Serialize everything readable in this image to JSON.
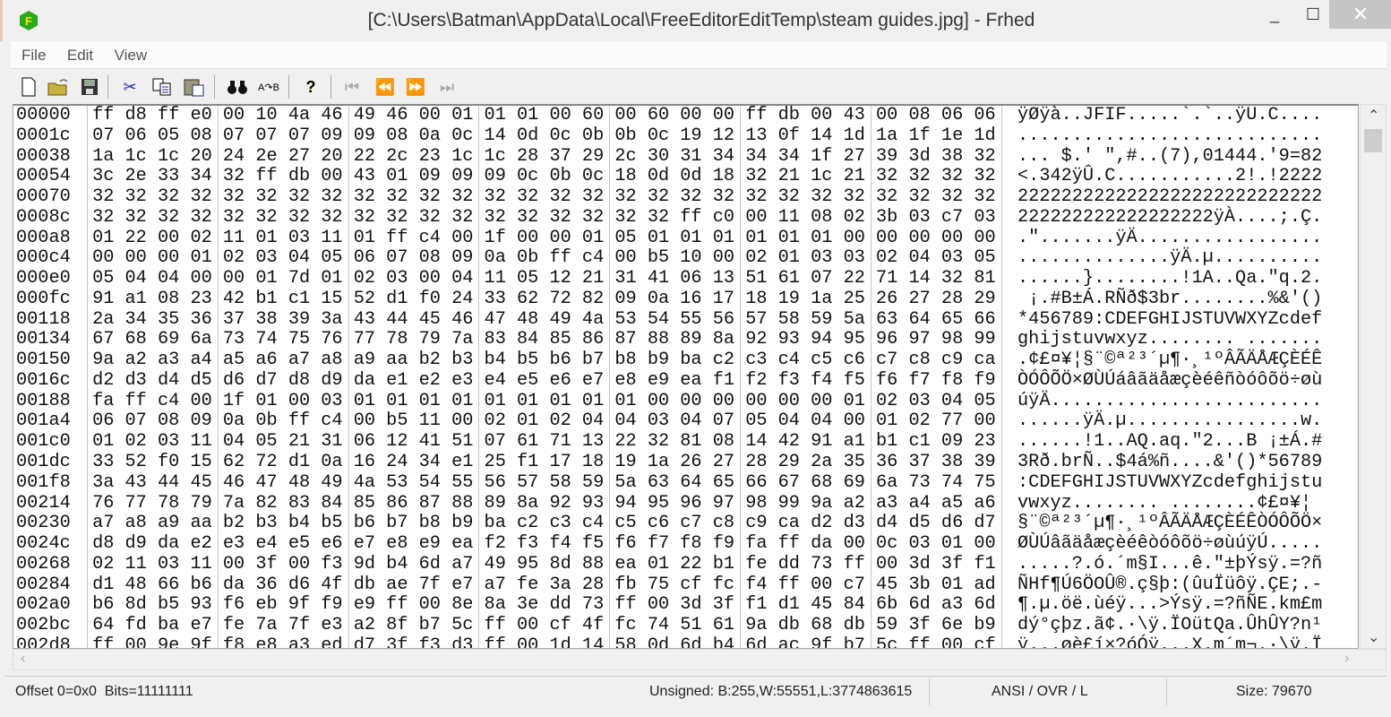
{
  "window": {
    "title": "[C:\\Users\\Batman\\AppData\\Local\\FreeEditorEditTemp\\steam guides.jpg] - Frhed",
    "app_icon_letter": "F",
    "minimize": "_",
    "maximize": "☐",
    "close": "✕"
  },
  "menu": [
    "File",
    "Edit",
    "View"
  ],
  "toolbar": {
    "icons": [
      "new-file-icon",
      "open-folder-icon",
      "save-icon",
      "cut-icon",
      "copy-icon",
      "paste-icon",
      "find-icon",
      "goto-icon",
      "help-icon",
      "first-icon",
      "previous-icon",
      "next-icon",
      "last-icon"
    ]
  },
  "colors": {
    "close_bg": "#c6c6c6",
    "app_icon": "#2aa81c"
  },
  "rows": [
    {
      "offset": "00000",
      "hex": "ff d8 ff e0 00 10 4a 46 49 46 00 01 01 01 00 60 00 60 00 00 ff db 00 43 00 08 06 06",
      "ascii": "ÿØÿà..JFIF.....`.`..ÿÛ.C...."
    },
    {
      "offset": "0001c",
      "hex": "07 06 05 08 07 07 07 09 09 08 0a 0c 14 0d 0c 0b 0b 0c 19 12 13 0f 14 1d 1a 1f 1e 1d",
      "ascii": "............................"
    },
    {
      "offset": "00038",
      "hex": "1a 1c 1c 20 24 2e 27 20 22 2c 23 1c 1c 28 37 29 2c 30 31 34 34 34 1f 27 39 3d 38 32",
      "ascii": "... $.' \",#..(7),01444.'9=82"
    },
    {
      "offset": "00054",
      "hex": "3c 2e 33 34 32 ff db 00 43 01 09 09 09 0c 0b 0c 18 0d 0d 18 32 21 1c 21 32 32 32 32",
      "ascii": "<.342ÿÛ.C...........2!.!2222"
    },
    {
      "offset": "00070",
      "hex": "32 32 32 32 32 32 32 32 32 32 32 32 32 32 32 32 32 32 32 32 32 32 32 32 32 32 32 32",
      "ascii": "2222222222222222222222222222"
    },
    {
      "offset": "0008c",
      "hex": "32 32 32 32 32 32 32 32 32 32 32 32 32 32 32 32 32 32 ff c0 00 11 08 02 3b 03 c7 03",
      "ascii": "222222222222222222ÿÀ....;.Ç."
    },
    {
      "offset": "000a8",
      "hex": "01 22 00 02 11 01 03 11 01 ff c4 00 1f 00 00 01 05 01 01 01 01 01 01 00 00 00 00 00",
      "ascii": ".\".......ÿÄ................."
    },
    {
      "offset": "000c4",
      "hex": "00 00 00 01 02 03 04 05 06 07 08 09 0a 0b ff c4 00 b5 10 00 02 01 03 03 02 04 03 05",
      "ascii": "..............ÿÄ.µ.........."
    },
    {
      "offset": "000e0",
      "hex": "05 04 04 00 00 01 7d 01 02 03 00 04 11 05 12 21 31 41 06 13 51 61 07 22 71 14 32 81",
      "ascii": "......}........!1A..Qa.\"q.2."
    },
    {
      "offset": "000fc",
      "hex": "91 a1 08 23 42 b1 c1 15 52 d1 f0 24 33 62 72 82 09 0a 16 17 18 19 1a 25 26 27 28 29",
      "ascii": " ¡.#B±Á.RÑð$3br........%&'()"
    },
    {
      "offset": "00118",
      "hex": "2a 34 35 36 37 38 39 3a 43 44 45 46 47 48 49 4a 53 54 55 56 57 58 59 5a 63 64 65 66",
      "ascii": "*456789:CDEFGHIJSTUVWXYZcdef"
    },
    {
      "offset": "00134",
      "hex": "67 68 69 6a 73 74 75 76 77 78 79 7a 83 84 85 86 87 88 89 8a 92 93 94 95 96 97 98 99",
      "ascii": "ghijstuvwxyz........ ......."
    },
    {
      "offset": "00150",
      "hex": "9a a2 a3 a4 a5 a6 a7 a8 a9 aa b2 b3 b4 b5 b6 b7 b8 b9 ba c2 c3 c4 c5 c6 c7 c8 c9 ca",
      "ascii": ".¢£¤¥¦§¨©ª²³´µ¶·¸¹ºÂÃÄÅÆÇÈÉÊ"
    },
    {
      "offset": "0016c",
      "hex": "d2 d3 d4 d5 d6 d7 d8 d9 da e1 e2 e3 e4 e5 e6 e7 e8 e9 ea f1 f2 f3 f4 f5 f6 f7 f8 f9",
      "ascii": "ÒÓÔÕÖ×ØÙÚáâãäåæçèéêñòóôõö÷øù"
    },
    {
      "offset": "00188",
      "hex": "fa ff c4 00 1f 01 00 03 01 01 01 01 01 01 01 01 01 00 00 00 00 00 00 01 02 03 04 05",
      "ascii": "úÿÄ........................."
    },
    {
      "offset": "001a4",
      "hex": "06 07 08 09 0a 0b ff c4 00 b5 11 00 02 01 02 04 04 03 04 07 05 04 04 00 01 02 77 00",
      "ascii": "......ÿÄ.µ................w."
    },
    {
      "offset": "001c0",
      "hex": "01 02 03 11 04 05 21 31 06 12 41 51 07 61 71 13 22 32 81 08 14 42 91 a1 b1 c1 09 23",
      "ascii": "......!1..AQ.aq.\"2...B ¡±Á.#"
    },
    {
      "offset": "001dc",
      "hex": "33 52 f0 15 62 72 d1 0a 16 24 34 e1 25 f1 17 18 19 1a 26 27 28 29 2a 35 36 37 38 39",
      "ascii": "3Rð.brÑ..$4á%ñ....&'()*56789"
    },
    {
      "offset": "001f8",
      "hex": "3a 43 44 45 46 47 48 49 4a 53 54 55 56 57 58 59 5a 63 64 65 66 67 68 69 6a 73 74 75",
      "ascii": ":CDEFGHIJSTUVWXYZcdefghijstu"
    },
    {
      "offset": "00214",
      "hex": "76 77 78 79 7a 82 83 84 85 86 87 88 89 8a 92 93 94 95 96 97 98 99 9a a2 a3 a4 a5 a6",
      "ascii": "vwxyz........ ........¢£¤¥¦"
    },
    {
      "offset": "00230",
      "hex": "a7 a8 a9 aa b2 b3 b4 b5 b6 b7 b8 b9 ba c2 c3 c4 c5 c6 c7 c8 c9 ca d2 d3 d4 d5 d6 d7",
      "ascii": "§¨©ª²³´µ¶·¸¹ºÂÃÄÅÆÇÈÉÊÒÓÔÕÖ×"
    },
    {
      "offset": "0024c",
      "hex": "d8 d9 da e2 e3 e4 e5 e6 e7 e8 e9 ea f2 f3 f4 f5 f6 f7 f8 f9 fa ff da 00 0c 03 01 00",
      "ascii": "ØÙÚâãäåæçèéêòóôõö÷øùúÿÚ....."
    },
    {
      "offset": "00268",
      "hex": "02 11 03 11 00 3f 00 f3 9d b4 6d a7 49 95 8d 88 ea 01 22 b1 fe dd 73 ff 00 3d 3f f1",
      "ascii": ".....?.ó.´m§I...ê.\"±þÝsÿ.=?ñ"
    },
    {
      "offset": "00284",
      "hex": "d1 48 66 b6 da 36 d6 4f db ae 7f e7 a7 fe 3a 28 fb 75 cf fc f4 ff 00 c7 45 3b 01 ad",
      "ascii": "ÑHf¶Ú6ÖOÛ®.ç§þ:(ûuÏüôÿ.ÇE;.-"
    },
    {
      "offset": "002a0",
      "hex": "b6 8d b5 93 f6 eb 9f f9 e9 ff 00 8e 8a 3e dd 73 ff 00 3d 3f f1 d1 45 84 6b 6d a3 6d",
      "ascii": "¶.µ.öë.ùéÿ...>Ýsÿ.=?ñÑE.km£m"
    },
    {
      "offset": "002bc",
      "hex": "64 fd ba e7 fe 7a 7f e3 a2 8f b7 5c ff 00 cf 4f fc 74 51 61 9a db 68 db 59 3f 6e b9",
      "ascii": "dý°çþz.ã¢.·\\ÿ.ÏOütQa.ÛhÛY?n¹"
    },
    {
      "offset": "002d8",
      "hex": "ff 00 9e 9f f8 e8 a3 ed d7 3f f3 d3 ff 00 1d 14 58 0d 6d b4 6d ac 9f b7 5c ff 00 cf",
      "ascii": "ÿ...øè£í×?óÓÿ...X.m´m¬.·\\ÿ.Ï"
    }
  ],
  "status": {
    "offset": "Offset 0=0x0  Bits=11111111",
    "unsigned": "Unsigned: B:255,W:55551,L:3774863615",
    "mode": "ANSI / OVR / L",
    "size": "Size: 79670"
  }
}
